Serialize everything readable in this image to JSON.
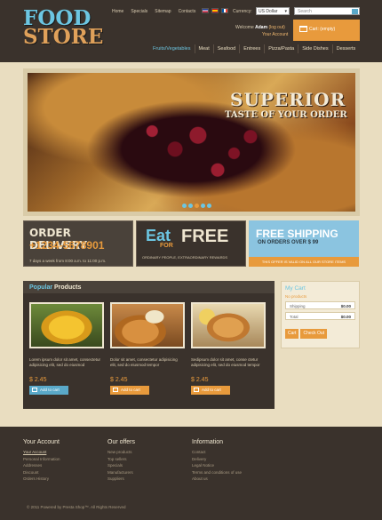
{
  "logo": {
    "line1": "FOOD",
    "line2": "STORE"
  },
  "topnav": [
    "Home",
    "Specials",
    "Sitemap",
    "Contacts"
  ],
  "currency": {
    "label": "Currency:",
    "selected": "US Dollar"
  },
  "search": {
    "placeholder": "Search"
  },
  "welcome": {
    "prefix": "Welcome",
    "name": "Adam",
    "logout": "(log out)",
    "account": "Your Account"
  },
  "cart_button": {
    "label": "Cart: (empty)"
  },
  "mainnav": [
    "Fruits/Vegetables",
    "Meat",
    "Seafood",
    "Entrees",
    "Pizza/Pasta",
    "Side Dishes",
    "Desserts"
  ],
  "banner": {
    "title": "SUPERIOR",
    "subtitle": "TASTE OF YOUR ORDER",
    "slides": 5,
    "active_slide": 3
  },
  "promos": {
    "delivery": {
      "title": "ORDER DELIVERY",
      "phone": "+1234-5678901",
      "hours": "7 days a week from 8:00 a.m. to 11:00 p.m."
    },
    "eat": {
      "eat": "Eat",
      "for": "FOR",
      "free": "FREE",
      "sub": "ORDINARY PEOPLE, EXTRAORDINARY REWARDS"
    },
    "shipping": {
      "title": "FREE SHIPPING",
      "sub": "ON ORDERS OVER $ 99",
      "note": "THIS OFFER IS VALID ON ALL OUR STORE ITEMS"
    }
  },
  "popular": {
    "title_hl": "Popular",
    "title_rest": "Products",
    "products": [
      {
        "desc": "Lorem ipsum dolor sit amet, consectetur adipisicing elit, sed do eiusmod",
        "price": "$ 2.45",
        "button": "Add to cart"
      },
      {
        "desc": "Dolor sit amet, consectetur adipisicing elit, sed do eiusmod tempor",
        "price": "$ 2.45",
        "button": "Add to cart"
      },
      {
        "desc": "Sedipsum dolor sit amet, conse ctetur adipisicing elit, sed do eiusmod tempor",
        "price": "$ 2.45",
        "button": "Add to cart"
      }
    ]
  },
  "mycart": {
    "title": "My Cart",
    "empty": "No products",
    "shipping_label": "Shipping",
    "shipping_value": "$0.00",
    "total_label": "Total",
    "total_value": "$0.00",
    "cart_btn": "Cart",
    "checkout_btn": "Check Out"
  },
  "footer": {
    "account": {
      "title": "Your Account",
      "links": [
        "Your Account",
        "Personal Information",
        "Addresses",
        "Discount",
        "Orders History"
      ]
    },
    "offers": {
      "title": "Our offers",
      "links": [
        "New products",
        "Top sellers",
        "Specials",
        "Manufacturers",
        "Suppliers"
      ]
    },
    "info": {
      "title": "Information",
      "links": [
        "Contact",
        "Delivery",
        "Legal Notice",
        "Terms and conditions of use",
        "About us"
      ]
    },
    "copyright": "© 2011 Powered by Presta Shop™. All Rights Reserved"
  }
}
